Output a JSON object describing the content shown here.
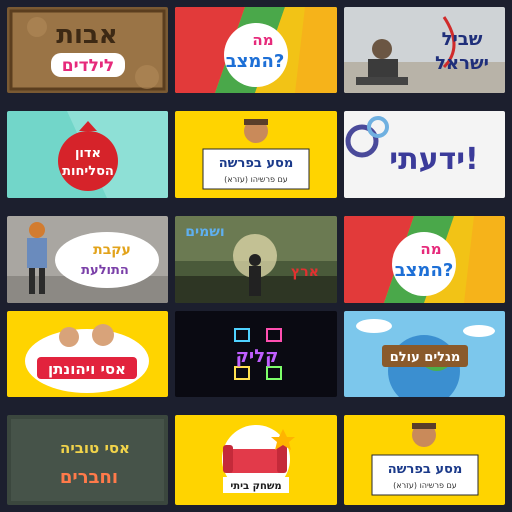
{
  "grid": {
    "tiles": [
      {
        "title_line1": "אבות",
        "title_line2": "לילדים"
      },
      {
        "title_line1": "מה",
        "title_line2": "המצב?"
      },
      {
        "title_line1": "שביל",
        "title_line2": "ישראל"
      },
      {
        "title_line1": "אדון",
        "title_line2": "הסליחות"
      },
      {
        "title": "מסע בפרשה",
        "subtitle": "עם פרשיהו (עזרא)"
      },
      {
        "title": "ידעתי!"
      },
      {
        "title_line1": "עקבת",
        "title_line2": "התולעת"
      },
      {
        "title_line1": "ושמים",
        "title_line2": "ארץ"
      },
      {
        "title_line1": "מה",
        "title_line2": "המצב?"
      },
      {
        "title": "אסי ויהונתן"
      },
      {
        "title": "קליק"
      },
      {
        "title": "מגלים עולם"
      },
      {
        "title_line1": "אסי טוביה",
        "title_line2": "וחברים"
      },
      {
        "title": "משחק ביתי"
      },
      {
        "title": "מסע בפרשה",
        "subtitle": "עם פרשיהו (עזרא)"
      }
    ]
  },
  "colors": {
    "background": "#1c1f2e",
    "accent_yellow": "#ffd400",
    "accent_red": "#d32d2d",
    "accent_green": "#3fa34d"
  }
}
